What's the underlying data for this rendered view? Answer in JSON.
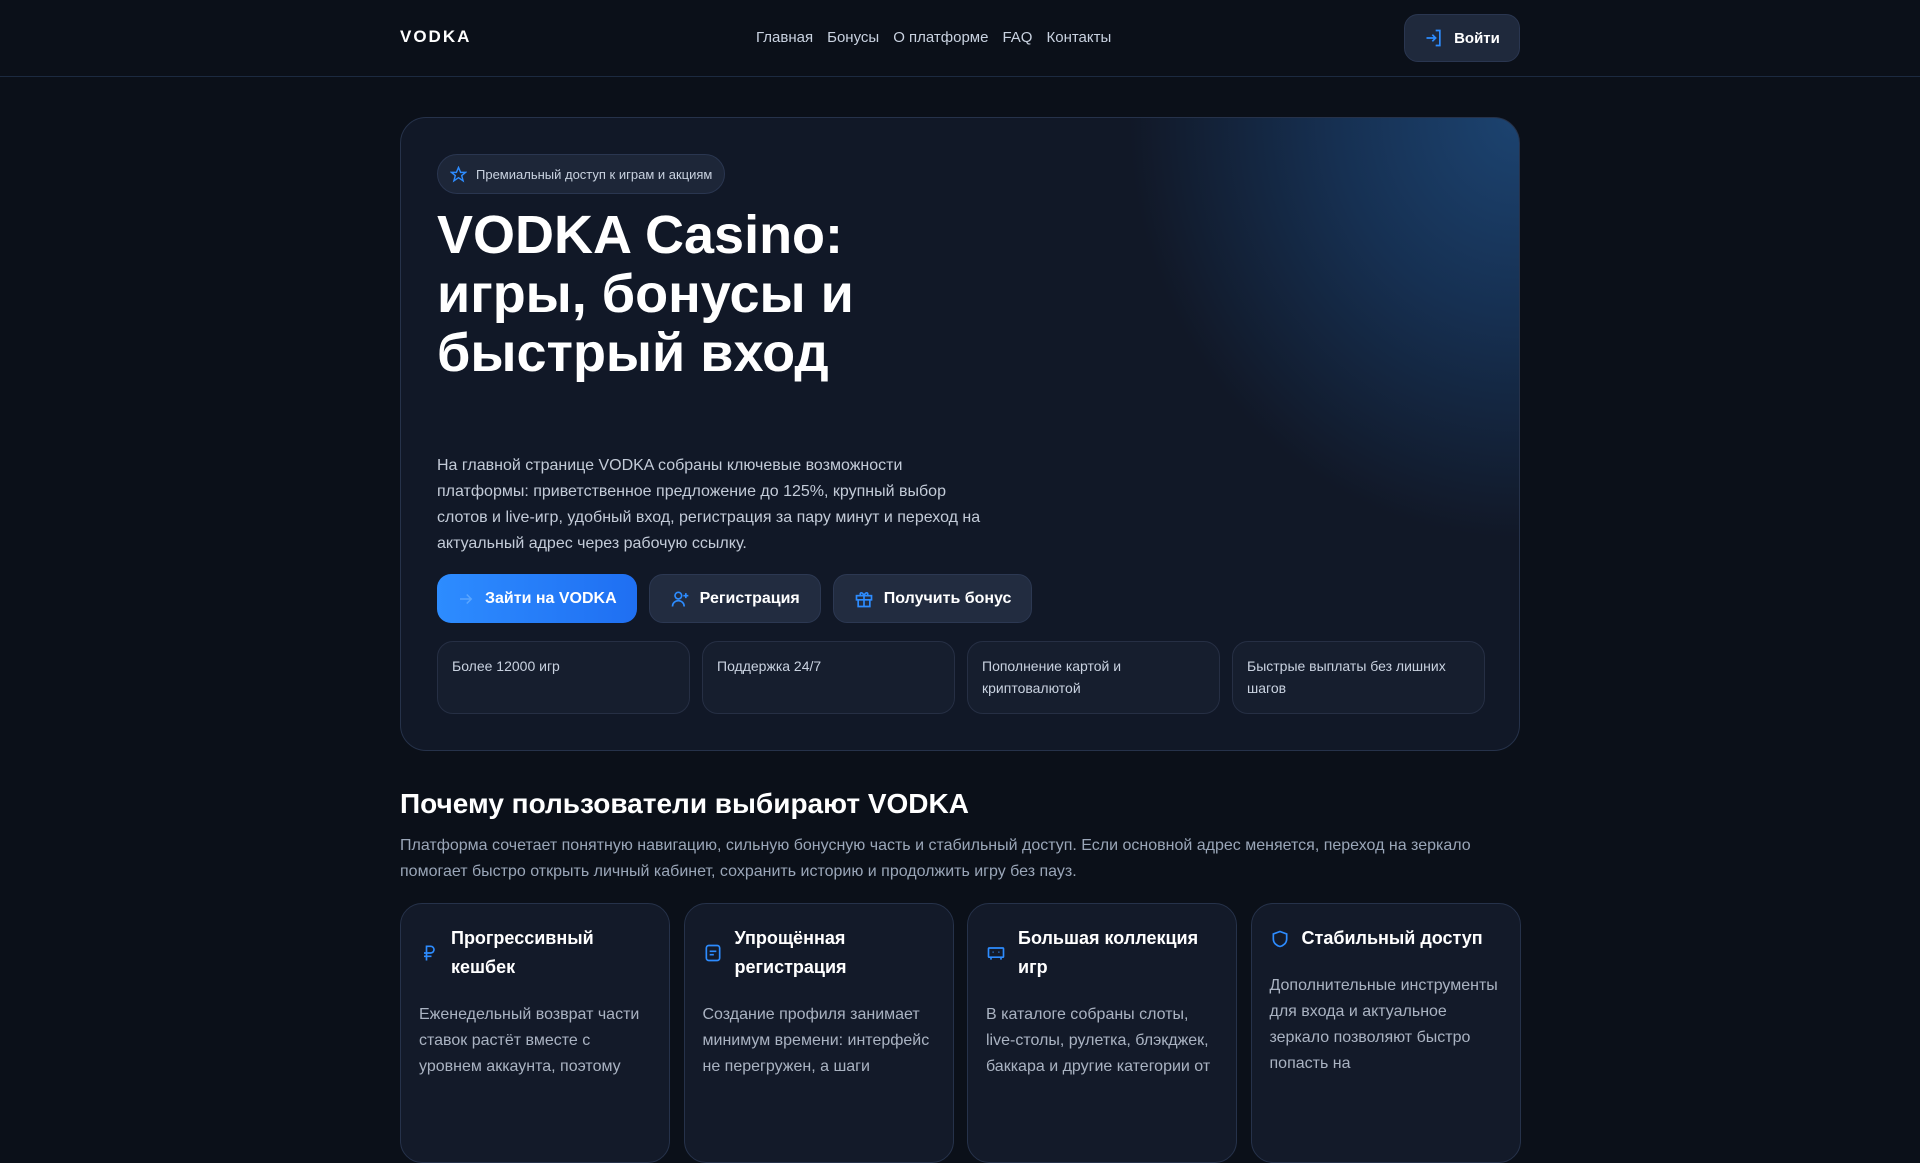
{
  "header": {
    "logo": "VODKA",
    "nav": [
      "Главная",
      "Бонусы",
      "О платформе",
      "FAQ",
      "Контакты"
    ],
    "login": "Войти"
  },
  "hero": {
    "badge": "Премиальный доступ к играм и акциям",
    "title": "VODKA Casino: игры, бонусы и быстрый вход",
    "description": "На главной странице VODKA собраны ключевые возможности платформы: приветственное предложение до 125%, крупный выбор слотов и live-игр, удобный вход, регистрация за пару минут и переход на актуальный адрес через рабочую ссылку.",
    "buttons": [
      "Зайти на VODKA",
      "Регистрация",
      "Получить бонус"
    ],
    "features": [
      "Более 12000 игр",
      "Поддержка 24/7",
      "Пополнение картой и криптовалютой",
      "Быстрые выплаты без лишних шагов"
    ]
  },
  "why": {
    "title": "Почему пользователи выбирают VODKA",
    "description": "Платформа сочетает понятную навигацию, сильную бонусную часть и стабильный доступ. Если основной адрес меняется, переход на зеркало помогает быстро открыть личный кабинет, сохранить историю и продолжить игру без пауз.",
    "cards": [
      {
        "title": "Прогрессивный кешбек",
        "text": "Еженедельный возврат части ставок растёт вместе с уровнем аккаунта, поэтому"
      },
      {
        "title": "Упрощённая регистрация",
        "text": "Создание профиля занимает минимум времени: интерфейс не перегружен, а шаги"
      },
      {
        "title": "Большая коллекция игр",
        "text": "В каталоге собраны слоты, live-столы, рулетка, блэкджек, баккара и другие категории от"
      },
      {
        "title": "Стабильный доступ",
        "text": "Дополнительные инструменты для входа и актуальное зеркало позволяют быстро попасть на"
      }
    ]
  },
  "colors": {
    "accent": "#2d8cff",
    "bg": "#0b1019",
    "card": "#111827"
  }
}
